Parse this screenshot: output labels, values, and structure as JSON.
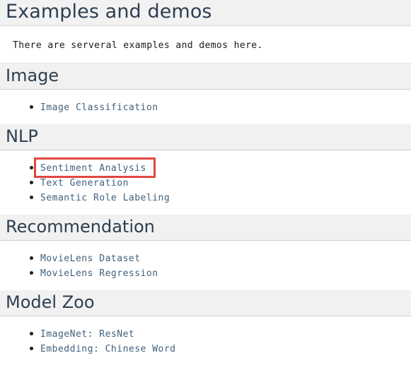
{
  "page": {
    "title": "Examples and demos",
    "intro": "There are serveral examples and demos here."
  },
  "colors": {
    "heading_text": "#2d3f52",
    "link_text": "#42617c",
    "band_background": "#f1f1f1",
    "highlight_border": "#e0483f",
    "page_background": "#ffffff"
  },
  "sections": [
    {
      "heading": "Image",
      "items": [
        {
          "label": "Image Classification",
          "highlighted": false
        }
      ]
    },
    {
      "heading": "NLP",
      "items": [
        {
          "label": "Sentiment Analysis",
          "highlighted": true
        },
        {
          "label": "Text Generation",
          "highlighted": false
        },
        {
          "label": "Semantic Role Labeling",
          "highlighted": false
        }
      ]
    },
    {
      "heading": "Recommendation",
      "items": [
        {
          "label": "MovieLens Dataset",
          "highlighted": false
        },
        {
          "label": "MovieLens Regression",
          "highlighted": false
        }
      ]
    },
    {
      "heading": "Model Zoo",
      "items": [
        {
          "label": "ImageNet: ResNet",
          "highlighted": false
        },
        {
          "label": "Embedding: Chinese Word",
          "highlighted": false
        }
      ]
    }
  ]
}
